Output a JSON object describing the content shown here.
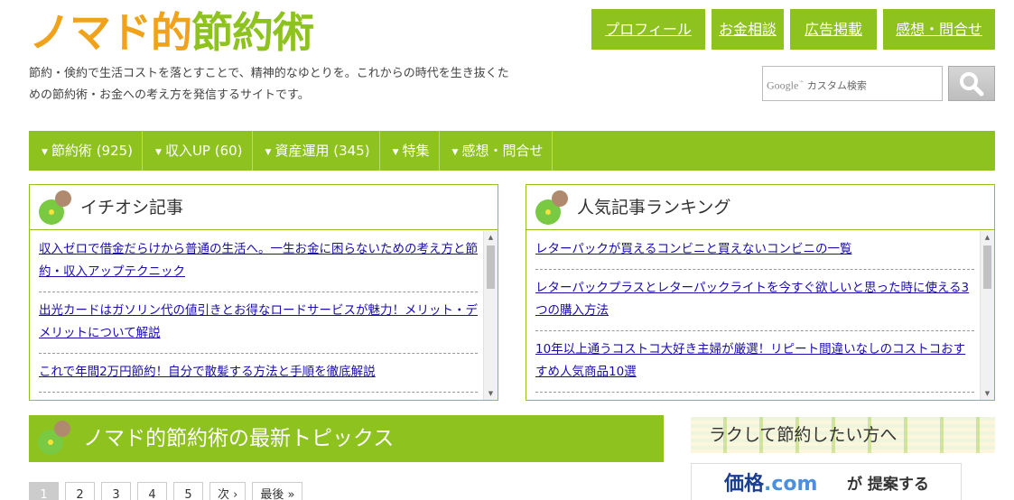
{
  "header": {
    "logo_part1": "ノマド的",
    "logo_part2": "節約術",
    "tagline": "節約・倹約で生活コストを落とすことで、精神的なゆとりを。これからの時代を生き抜くための節約術・お金への考え方を発信するサイトです。"
  },
  "topnav": [
    "プロフィール",
    "お金相談",
    "広告掲載",
    "感想・問合せ"
  ],
  "search": {
    "google_label": "Google",
    "placeholder": "カスタム検索",
    "button_icon": "search-icon"
  },
  "mainnav": [
    "節約術 (925)",
    "収入UP (60)",
    "資産運用 (345)",
    "特集",
    "感想・問合せ"
  ],
  "featured": {
    "title": "イチオシ記事",
    "items": [
      "収入ゼロで借金だらけから普通の生活へ。一生お金に困らないための考え方と節約・収入アップテクニック",
      "出光カードはガソリン代の値引きとお得なロードサービスが魅力！メリット・デメリットについて解説",
      "これで年間2万円節約！自分で散髪する方法と手順を徹底解説"
    ]
  },
  "ranking": {
    "title": "人気記事ランキング",
    "items": [
      "レターパックが買えるコンビニと買えないコンビニの一覧",
      "レターパックプラスとレターパックライトを今すぐ欲しいと思った時に使える3つの購入方法",
      "10年以上通うコストコ大好き主婦が厳選！リピート間違いなしのコストコおすすめ人気商品10選"
    ]
  },
  "topics": {
    "title": "ノマド的節約術の最新トピックス"
  },
  "pager": {
    "pages": [
      "1",
      "2",
      "3",
      "4",
      "5"
    ],
    "next": "次 ›",
    "last": "最後 »"
  },
  "side": {
    "title": "ラクして節約したい方へ",
    "ad_brand": "価格",
    "ad_com": ".com",
    "ad_rest": "が 提案する"
  }
}
